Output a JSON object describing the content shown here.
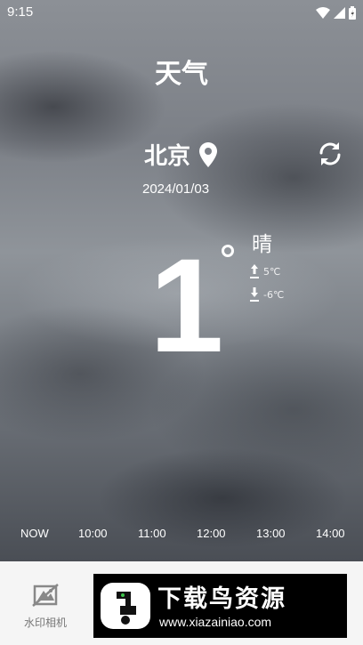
{
  "status_bar": {
    "time": "9:15",
    "icons": [
      "wifi-icon",
      "signal-icon",
      "battery-icon"
    ]
  },
  "app_title": "天气",
  "location": {
    "city": "北京",
    "date": "2024/01/03"
  },
  "current": {
    "temperature": "1",
    "condition": "晴",
    "high": "5℃",
    "low": "-6℃"
  },
  "hourly": [
    "NOW",
    "10:00",
    "11:00",
    "12:00",
    "13:00",
    "14:00"
  ],
  "bottom_bar": {
    "camera_label": "水印相机"
  },
  "ad": {
    "title": "下载鸟资源",
    "url": "www.xiazainiao.com"
  },
  "colors": {
    "text": "#ffffff",
    "bottom_bg": "#f5f5f5",
    "ad_bg": "#000000"
  }
}
